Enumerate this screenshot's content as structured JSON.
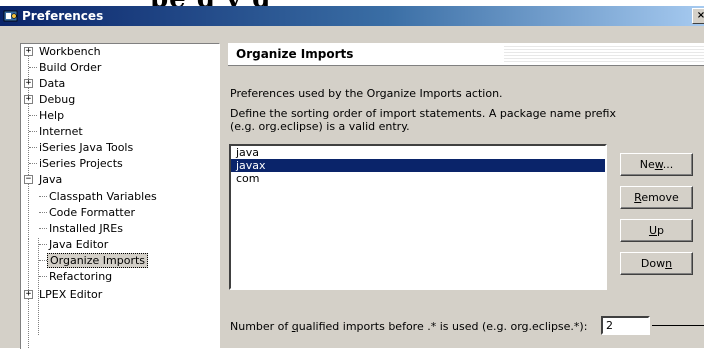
{
  "window": {
    "title": "Preferences",
    "close_glyph": "×"
  },
  "tree": {
    "items": [
      {
        "label": "Workbench",
        "expander": "+"
      },
      {
        "label": "Build Order"
      },
      {
        "label": "Data",
        "expander": "+"
      },
      {
        "label": "Debug",
        "expander": "+"
      },
      {
        "label": "Help"
      },
      {
        "label": "Internet"
      },
      {
        "label": "iSeries Java Tools"
      },
      {
        "label": "iSeries Projects"
      },
      {
        "label": "Java",
        "expander": "−"
      },
      {
        "label": "Classpath Variables"
      },
      {
        "label": "Code Formatter"
      },
      {
        "label": "Installed JREs"
      },
      {
        "label": "Java Editor"
      },
      {
        "label": "Organize Imports",
        "selected": true
      },
      {
        "label": "Refactoring"
      },
      {
        "label": "LPEX Editor",
        "expander": "+"
      }
    ]
  },
  "page": {
    "title": "Organize Imports",
    "description": "Preferences used by the Organize Imports action.",
    "instruction_line1": "Define the sorting order of import statements. A package name prefix",
    "instruction_line2": "(e.g. org.eclipse) is a valid entry."
  },
  "import_order": {
    "items": [
      "java",
      "javax",
      "com"
    ],
    "selected": "javax"
  },
  "buttons": {
    "new": {
      "pre": "Ne",
      "key": "w",
      "post": "..."
    },
    "remove": {
      "pre": "",
      "key": "R",
      "post": "emove"
    },
    "up": {
      "pre": "",
      "key": "U",
      "post": "p"
    },
    "down": {
      "pre": "Dow",
      "key": "n",
      "post": ""
    }
  },
  "qualified_imports": {
    "label_pre": "Number of ",
    "label_key": "q",
    "label_post": "ualified imports before .* is used (e.g. org.eclipse.*):",
    "value": "2"
  },
  "colors": {
    "selection": "#0a246a",
    "titlebar": "#0a246a",
    "dialog_bg": "#d4d0c8"
  },
  "icons": {
    "app": "preferences-icon"
  }
}
